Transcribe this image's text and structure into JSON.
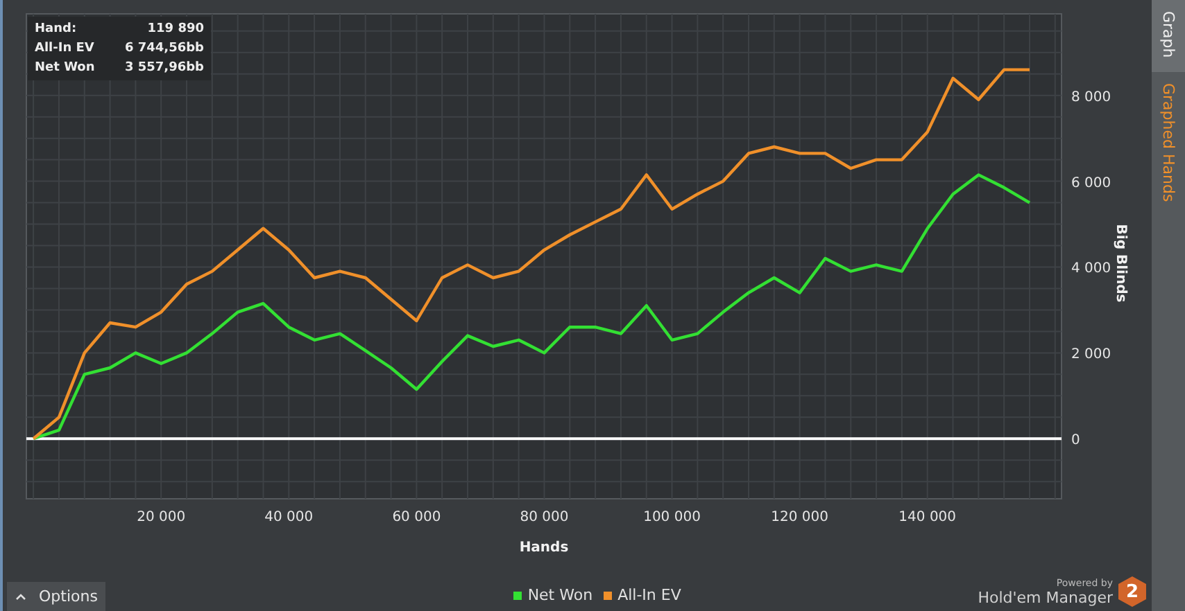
{
  "info_box": {
    "rows": [
      {
        "label": "Hand:",
        "value": "119 890"
      },
      {
        "label": "All-In EV",
        "value": "6 744,56bb"
      },
      {
        "label": "Net Won",
        "value": "3 557,96bb"
      }
    ]
  },
  "chart": {
    "chart_data": {
      "type": "line",
      "xlabel": "Hands",
      "ylabel": "Big Blinds",
      "x": [
        0,
        4000,
        8000,
        12000,
        16000,
        20000,
        24000,
        28000,
        32000,
        36000,
        40000,
        44000,
        48000,
        52000,
        56000,
        60000,
        64000,
        68000,
        72000,
        76000,
        80000,
        84000,
        88000,
        92000,
        96000,
        100000,
        104000,
        108000,
        112000,
        116000,
        120000,
        124000,
        128000,
        132000,
        136000,
        140000,
        144000,
        148000,
        152000,
        156000
      ],
      "series": [
        {
          "name": "Net Won",
          "color": "#33e033",
          "values": [
            0,
            200,
            1500,
            1650,
            2000,
            1750,
            2000,
            2450,
            2950,
            3150,
            2600,
            2300,
            2450,
            2050,
            1650,
            1150,
            1800,
            2400,
            2150,
            2300,
            2000,
            2600,
            2600,
            2450,
            3100,
            2300,
            2450,
            2950,
            3400,
            3750,
            3400,
            4200,
            3900,
            4050,
            3900,
            4900,
            5700,
            6150,
            5850,
            5500
          ]
        },
        {
          "name": "All-In EV",
          "color": "#f0902a",
          "values": [
            0,
            500,
            2000,
            2700,
            2600,
            2950,
            3600,
            3900,
            4400,
            4900,
            4400,
            3750,
            3900,
            3750,
            3250,
            2750,
            3750,
            4050,
            3750,
            3900,
            4400,
            4750,
            5050,
            5350,
            6150,
            5350,
            5700,
            6000,
            6650,
            6800,
            6650,
            6650,
            6300,
            6500,
            6500,
            7150,
            8400,
            7900,
            8600,
            8600
          ]
        }
      ],
      "grid": true,
      "xlim": [
        -1100,
        161000
      ],
      "ylim": [
        -1400,
        9900
      ],
      "xticks": [
        {
          "value": 20000,
          "label": "20 000"
        },
        {
          "value": 40000,
          "label": "40 000"
        },
        {
          "value": 60000,
          "label": "60 000"
        },
        {
          "value": 80000,
          "label": "80 000"
        },
        {
          "value": 100000,
          "label": "100 000"
        },
        {
          "value": 120000,
          "label": "120 000"
        },
        {
          "value": 140000,
          "label": "140 000"
        }
      ],
      "yticks": [
        {
          "value": 0,
          "label": "0"
        },
        {
          "value": 2000,
          "label": "2 000"
        },
        {
          "value": 4000,
          "label": "4 000"
        },
        {
          "value": 6000,
          "label": "6 000"
        },
        {
          "value": 8000,
          "label": "8 000"
        }
      ]
    }
  },
  "options_button": {
    "label": "Options"
  },
  "branding": {
    "powered_by": "Powered by",
    "product": "Hold'em Manager",
    "logo_text": "2"
  },
  "tabs": [
    {
      "label": "Graph",
      "selected": true
    },
    {
      "label": "Graphed Hands",
      "selected": false
    }
  ]
}
